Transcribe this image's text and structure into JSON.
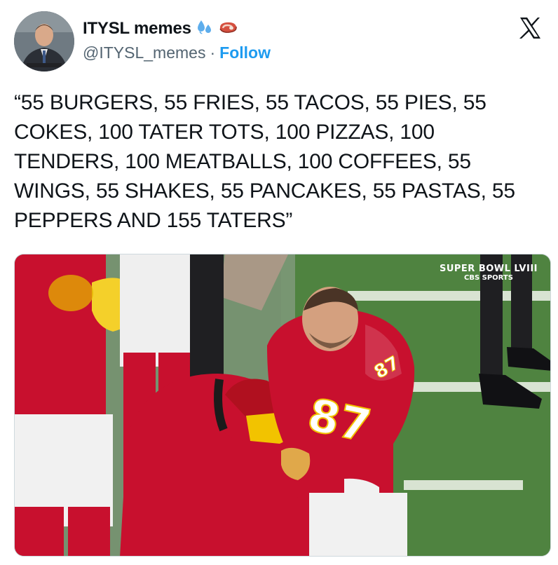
{
  "author": {
    "display_name": "ITYSL memes",
    "handle": "@ITYSL_memes",
    "separator": "·",
    "follow_label": "Follow",
    "name_emojis": [
      "sweat-droplets-emoji",
      "steak-emoji"
    ]
  },
  "platform": {
    "logo": "x-logo-icon"
  },
  "tweet": {
    "text": "“55 BURGERS, 55 FRIES, 55 TACOS, 55 PIES, 55 COKES, 100 TATER TOTS, 100 PIZZAS, 100 TENDERS, 100 MEATBALLS, 100 COFFEES, 55 WINGS, 55 SHAKES, 55 PANCAKES, 55 PASTAS, 55 PEPPERS AND 155 TATERS”"
  },
  "media": {
    "broadcast_title": "SUPER BOWL LVIII",
    "broadcast_network": "CBS SPORTS",
    "jersey_number": "87"
  },
  "colors": {
    "text": "#0f1419",
    "secondary": "#536471",
    "accent": "#1d9bf0",
    "jersey_red": "#c8102e",
    "field_green": "#4a7a3c",
    "cap_gold": "#f2c300"
  }
}
